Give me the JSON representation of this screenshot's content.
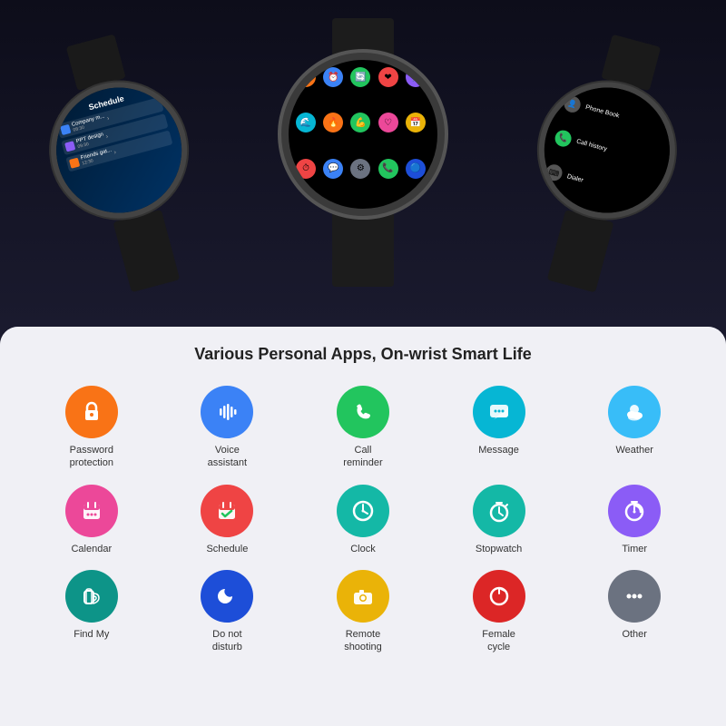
{
  "header": {
    "title": "Various Personal Apps, On-wrist Smart Life"
  },
  "watches": {
    "left": {
      "screen": "schedule",
      "title": "Schedule",
      "items": [
        {
          "icon_color": "#3b82f6",
          "text": "Company m...",
          "time": "08:30"
        },
        {
          "icon_color": "#8b5cf6",
          "text": "PPT design",
          "time": "09:30"
        },
        {
          "icon_color": "#f97316",
          "text": "Friends gat...",
          "time": "12:30"
        }
      ]
    },
    "center": {
      "screen": "apps"
    },
    "right": {
      "screen": "phone",
      "items": [
        {
          "icon_color": "#6b7280",
          "label": "Phone Book",
          "icon": "👤"
        },
        {
          "icon_color": "#22c55e",
          "label": "Call history",
          "icon": "📞"
        },
        {
          "icon_color": "#6b7280",
          "label": "Dialer",
          "icon": "⌨️"
        }
      ]
    }
  },
  "apps": [
    {
      "id": "password-protection",
      "label": "Password\nprotection",
      "bg": "bg-orange",
      "icon": "lock"
    },
    {
      "id": "voice-assistant",
      "label": "Voice\nassistant",
      "bg": "bg-blue",
      "icon": "mic"
    },
    {
      "id": "call-reminder",
      "label": "Call\nreminder",
      "bg": "bg-green",
      "icon": "phone"
    },
    {
      "id": "message",
      "label": "Message",
      "bg": "bg-cyan",
      "icon": "chat"
    },
    {
      "id": "weather",
      "label": "Weather",
      "bg": "bg-sky",
      "icon": "weather"
    },
    {
      "id": "calendar",
      "label": "Calendar",
      "bg": "bg-pink",
      "icon": "calendar"
    },
    {
      "id": "schedule",
      "label": "Schedule",
      "bg": "bg-red",
      "icon": "schedule"
    },
    {
      "id": "clock",
      "label": "Clock",
      "bg": "bg-teal",
      "icon": "clock"
    },
    {
      "id": "stopwatch",
      "label": "Stopwatch",
      "bg": "bg-teal",
      "icon": "stopwatch"
    },
    {
      "id": "timer",
      "label": "Timer",
      "bg": "bg-purple",
      "icon": "timer"
    },
    {
      "id": "find-my",
      "label": "Find My",
      "bg": "bg-dark-teal",
      "icon": "find"
    },
    {
      "id": "do-not-disturb",
      "label": "Do not\ndisturb",
      "bg": "bg-dark-blue",
      "icon": "moon"
    },
    {
      "id": "remote-shooting",
      "label": "Remote\nshooting",
      "bg": "bg-yellow",
      "icon": "camera"
    },
    {
      "id": "female-cycle",
      "label": "Female\ncycle",
      "bg": "bg-deep-red",
      "icon": "cycle"
    },
    {
      "id": "other",
      "label": "Other",
      "bg": "bg-gray",
      "icon": "dots"
    }
  ]
}
